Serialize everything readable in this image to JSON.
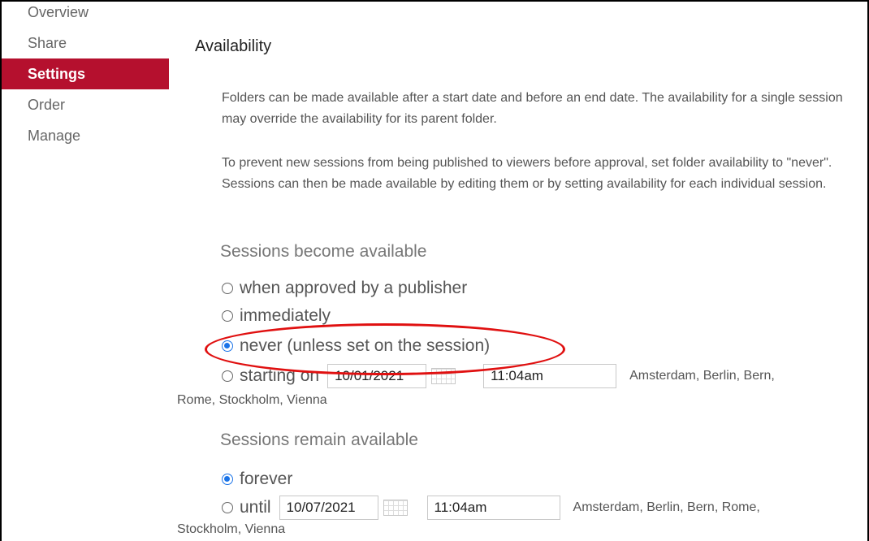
{
  "sidebar": {
    "items": [
      {
        "label": "Overview",
        "active": false
      },
      {
        "label": "Share",
        "active": false
      },
      {
        "label": "Settings",
        "active": true
      },
      {
        "label": "Order",
        "active": false
      },
      {
        "label": "Manage",
        "active": false
      }
    ]
  },
  "main": {
    "title": "Availability",
    "paragraph1": "Folders can be made available after a start date and before an end date. The availability for a single session may override the availability for its parent folder.",
    "paragraph2": "To prevent new sessions from being published to viewers before approval, set folder availability to \"never\". Sessions can then be made available by editing them or by setting availability for each individual session.",
    "become_available": {
      "label": "Sessions become available",
      "options": [
        {
          "label": "when approved by a publisher",
          "checked": false
        },
        {
          "label": "immediately",
          "checked": false
        },
        {
          "label": "never (unless set on the session)",
          "checked": true
        },
        {
          "label": "starting on",
          "checked": false
        }
      ],
      "start_date": "10/01/2021",
      "start_time": "11:04am",
      "timezone_line1": "Amsterdam, Berlin, Bern,",
      "timezone_line2": "Rome, Stockholm, Vienna"
    },
    "remain_available": {
      "label": "Sessions remain available",
      "options": [
        {
          "label": "forever",
          "checked": true
        },
        {
          "label": "until",
          "checked": false
        }
      ],
      "end_date": "10/07/2021",
      "end_time": "11:04am",
      "timezone_line1": "Amsterdam, Berlin, Bern, Rome,",
      "timezone_line2": "Stockholm, Vienna"
    }
  },
  "colors": {
    "accent": "#b5102e",
    "radio_checked": "#1a73e8",
    "annotation": "#e01010"
  }
}
